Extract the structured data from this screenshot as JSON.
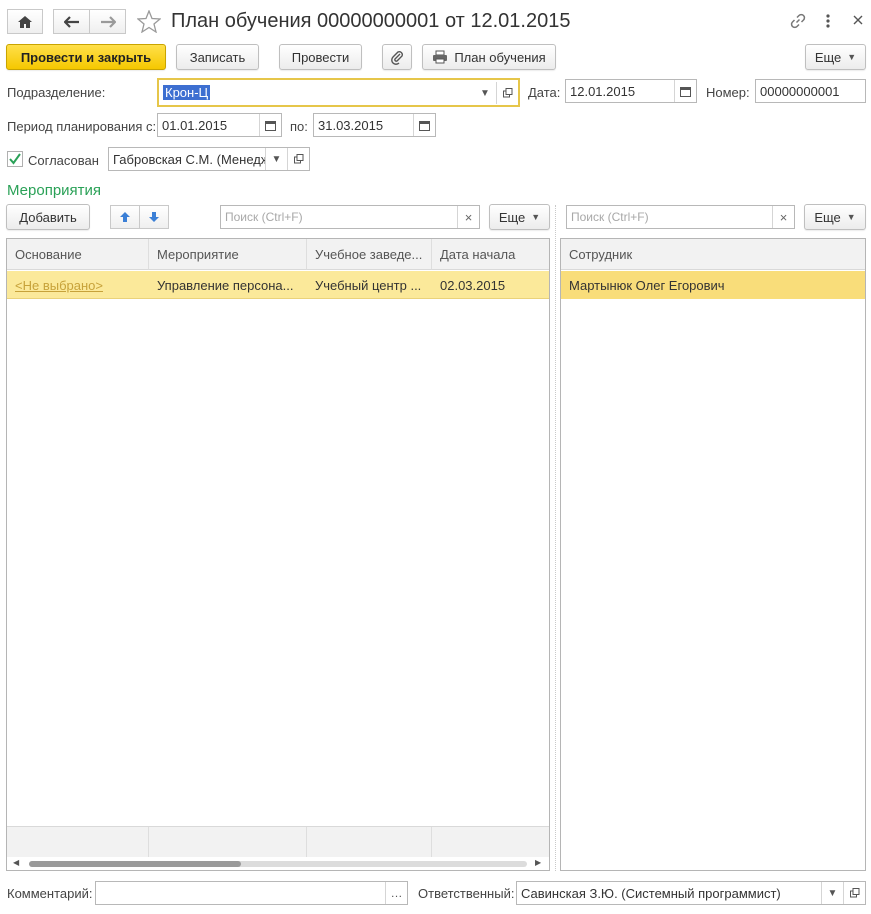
{
  "window": {
    "title": "План обучения 00000000001 от 12.01.2015"
  },
  "toolbar": {
    "post_close": "Провести и закрыть",
    "save": "Записать",
    "post": "Провести",
    "print_plan": "План обучения",
    "more": "Еще"
  },
  "form": {
    "department_label": "Подразделение:",
    "department_value": "Крон-Ц",
    "date_label": "Дата:",
    "date_value": "12.01.2015",
    "number_label": "Номер:",
    "number_value": "00000000001",
    "period_label": "Период планирования с:",
    "period_from": "01.01.2015",
    "period_to_label": "по:",
    "period_to": "31.03.2015",
    "approved_label": "Согласован",
    "approved_checked": true,
    "approver_value": "Габровская С.М. (Менеджер)",
    "comment_label": "Комментарий:",
    "comment_value": "",
    "responsible_label": "Ответственный:",
    "responsible_value": "Савинская З.Ю. (Системный программист)"
  },
  "events": {
    "section_title": "Мероприятия",
    "add_button": "Добавить",
    "search_placeholder": "Поиск (Ctrl+F)",
    "more": "Еще",
    "columns": [
      "Основание",
      "Мероприятие",
      "Учебное заведе...",
      "Дата начала"
    ],
    "rows": [
      {
        "basis": "<Не выбрано>",
        "event": "Управление персона...",
        "institution": "Учебный центр ...",
        "start_date": "02.03.2015"
      }
    ]
  },
  "employees": {
    "search_placeholder": "Поиск (Ctrl+F)",
    "more": "Еще",
    "column": "Сотрудник",
    "rows": [
      {
        "name": "Мартынюк Олег Егорович"
      }
    ]
  },
  "colors": {
    "accent_green": "#2aa157",
    "primary_yellow": "#f5c800",
    "selected_row": "#fbe99a",
    "focus_border": "#e6c64a"
  }
}
